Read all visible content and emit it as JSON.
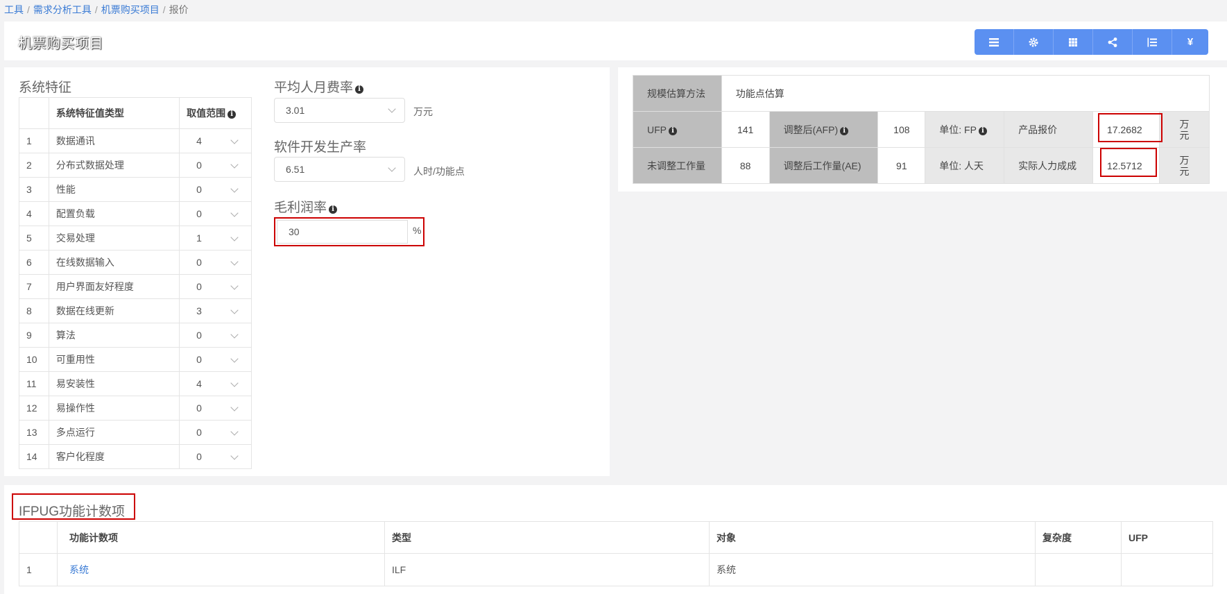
{
  "breadcrumb": {
    "items": [
      "工具",
      "需求分析工具",
      "机票购买项目",
      "报价"
    ]
  },
  "page": {
    "title": "机票购买项目"
  },
  "toolbar": {
    "buttons": [
      "list-icon",
      "gear-icon",
      "grid-icon",
      "share-icon",
      "ordered-list-icon",
      "yen-icon"
    ],
    "yen_label": "¥"
  },
  "features": {
    "title": "系统特征",
    "header_type": "系统特征值类型",
    "header_range": "取值范围",
    "rows": [
      {
        "no": "1",
        "name": "数据通讯",
        "value": "4"
      },
      {
        "no": "2",
        "name": "分布式数据处理",
        "value": "0"
      },
      {
        "no": "3",
        "name": "性能",
        "value": "0"
      },
      {
        "no": "4",
        "name": "配置负载",
        "value": "0"
      },
      {
        "no": "5",
        "name": "交易处理",
        "value": "1"
      },
      {
        "no": "6",
        "name": "在线数据输入",
        "value": "0"
      },
      {
        "no": "7",
        "name": "用户界面友好程度",
        "value": "0"
      },
      {
        "no": "8",
        "name": "数据在线更新",
        "value": "3"
      },
      {
        "no": "9",
        "name": "算法",
        "value": "0"
      },
      {
        "no": "10",
        "name": "可重用性",
        "value": "0"
      },
      {
        "no": "11",
        "name": "易安装性",
        "value": "4"
      },
      {
        "no": "12",
        "name": "易操作性",
        "value": "0"
      },
      {
        "no": "13",
        "name": "多点运行",
        "value": "0"
      },
      {
        "no": "14",
        "name": "客户化程度",
        "value": "0"
      }
    ]
  },
  "rate": {
    "label": "平均人月费率",
    "value": "3.01",
    "unit": "万元"
  },
  "productivity": {
    "label": "软件开发生产率",
    "value": "6.51",
    "unit": "人时/功能点"
  },
  "margin": {
    "label": "毛利润率",
    "value": "30",
    "unit": "%"
  },
  "estimate": {
    "method_label": "规模估算方法",
    "method_value": "功能点估算",
    "ufp_label": "UFP",
    "ufp_value": "141",
    "afp_label": "调整后(AFP)",
    "afp_value": "108",
    "unit_fp": "单位: FP",
    "price_label": "产品报价",
    "price_value": "17.2682",
    "price_unit": "万元",
    "work_label": "未调整工作量",
    "work_value": "88",
    "ae_label": "调整后工作量(AE)",
    "ae_value": "91",
    "unit_day": "单位: 人天",
    "cost_label": "实际人力成成",
    "cost_value": "12.5712",
    "cost_unit": "万元"
  },
  "ifpug": {
    "title": "IFPUG功能计数项",
    "headers": [
      "",
      "功能计数项",
      "类型",
      "对象",
      "复杂度",
      "UFP"
    ],
    "rows": [
      {
        "no": "1",
        "item": "系统",
        "type": "ILF",
        "object": "系统",
        "complexity": "",
        "ufp": ""
      }
    ]
  },
  "colors": {
    "accent": "#5b90f1",
    "highlight": "#cc0000",
    "link": "#3a7bd5"
  }
}
